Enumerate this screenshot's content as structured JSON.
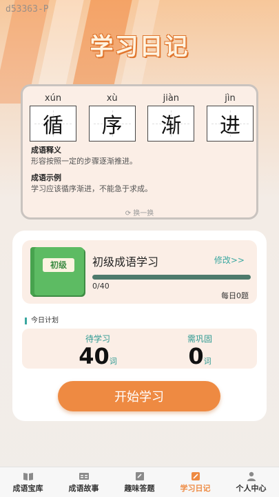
{
  "watermark": "d53363-P",
  "page_title": "学习日记",
  "idiom": {
    "characters": [
      {
        "pinyin": "xún",
        "char": "循"
      },
      {
        "pinyin": "xù",
        "char": "序"
      },
      {
        "pinyin": "jiàn",
        "char": "渐"
      },
      {
        "pinyin": "jìn",
        "char": "进"
      }
    ],
    "meaning_title": "成语释义",
    "meaning_text": "形容按照一定的步骤逐渐推进。",
    "example_title": "成语示例",
    "example_text": "学习应该循序渐进，不能急于求成。",
    "refresh_label": "换一换"
  },
  "level": {
    "book_label": "初级",
    "name": "初级成语学习",
    "modify_label": "修改>>",
    "progress_text": "0/40",
    "progress_fraction": 0,
    "daily_text": "每日0题"
  },
  "plan": {
    "label": "今日计划",
    "pending_title": "待学习",
    "pending_count": "40",
    "review_title": "需巩固",
    "review_count": "0",
    "unit": "词"
  },
  "start_button": "开始学习",
  "tabs": [
    {
      "label": "成语宝库",
      "icon": "book-icon"
    },
    {
      "label": "成语故事",
      "icon": "story-icon"
    },
    {
      "label": "趣味答题",
      "icon": "quiz-icon"
    },
    {
      "label": "学习日记",
      "icon": "diary-icon"
    },
    {
      "label": "个人中心",
      "icon": "user-icon"
    }
  ],
  "active_tab": 3,
  "colors": {
    "accent": "#ee8a42",
    "teal": "#3aa7a0",
    "book_green": "#5dbb63"
  }
}
